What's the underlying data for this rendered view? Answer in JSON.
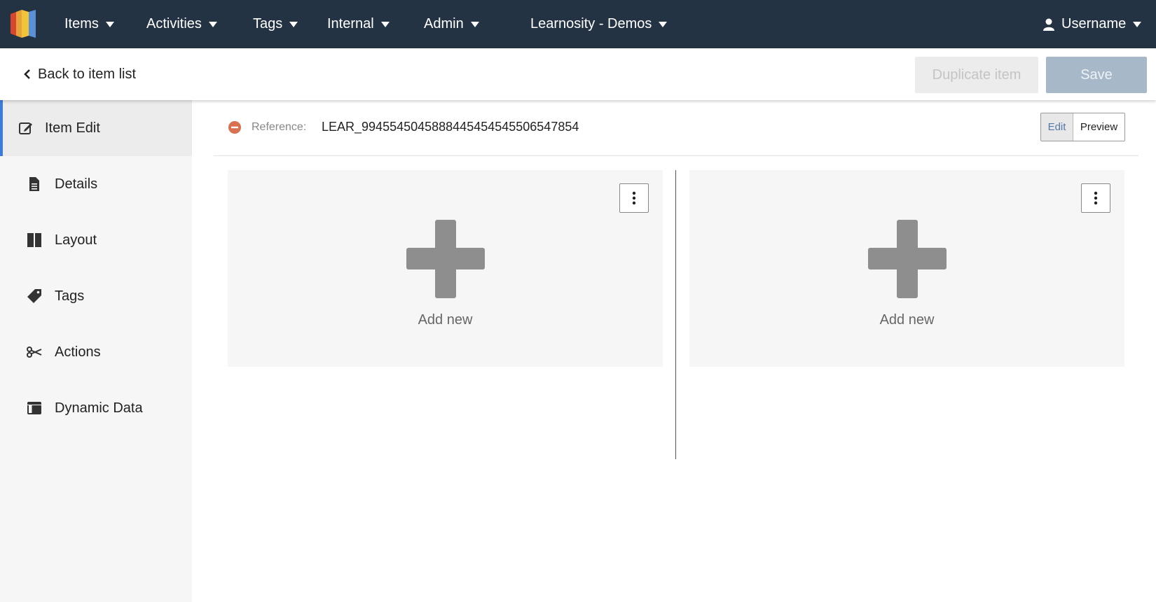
{
  "topnav": {
    "items": [
      {
        "label": "Items"
      },
      {
        "label": "Activities"
      },
      {
        "label": "Tags"
      },
      {
        "label": "Internal"
      },
      {
        "label": "Admin"
      },
      {
        "label": "Learnosity - Demos"
      }
    ],
    "user_label": "Username"
  },
  "toolbar": {
    "back_label": "Back to item list",
    "duplicate_label": "Duplicate item",
    "save_label": "Save"
  },
  "sidebar": {
    "items": [
      {
        "label": "Item Edit",
        "icon": "edit-icon",
        "active": true
      },
      {
        "label": "Details",
        "icon": "document-icon"
      },
      {
        "label": "Layout",
        "icon": "columns-icon"
      },
      {
        "label": "Tags",
        "icon": "tag-icon"
      },
      {
        "label": "Actions",
        "icon": "scissors-icon"
      },
      {
        "label": "Dynamic Data",
        "icon": "table-icon"
      }
    ]
  },
  "reference": {
    "label": "Reference:",
    "value": "LEAR_9945545045888445454545506547854"
  },
  "mode_toggle": {
    "edit_label": "Edit",
    "preview_label": "Preview",
    "selected": "Edit"
  },
  "panels": [
    {
      "add_label": "Add new"
    },
    {
      "add_label": "Add new"
    }
  ],
  "colors": {
    "nav_bg": "#233343",
    "accent": "#3d7bd9",
    "save_disabled": "#a7b9c9",
    "reference_icon": "#d9704f"
  }
}
